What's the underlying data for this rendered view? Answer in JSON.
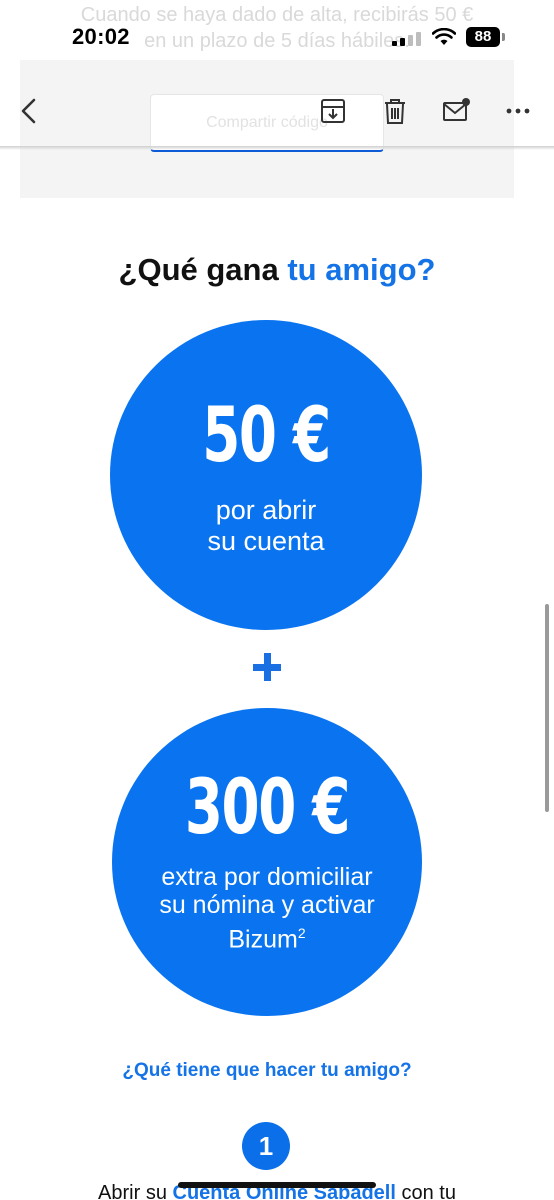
{
  "background_email": {
    "line1": "Cuando se haya dado de alta, recibirás 50 €",
    "line2": "en un plazo de 5 días hábiles.",
    "button_label": "Compartir código"
  },
  "status_bar": {
    "time": "20:02",
    "battery": "88"
  },
  "toolbar": {
    "icons": [
      "back-chevron-icon",
      "archive-icon",
      "trash-icon",
      "mark-unread-icon",
      "more-icon"
    ]
  },
  "heading": {
    "prefix": "¿Qué gana ",
    "accent": "tu amigo?"
  },
  "offer1": {
    "amount": "50 €",
    "line1": "por abrir",
    "line2": "su cuenta"
  },
  "offer2": {
    "amount": "300 €",
    "line1": "extra por domiciliar",
    "line2": "su nómina y activar",
    "line3": "Bizum",
    "superscript": "2"
  },
  "question_link": "¿Qué tiene que hacer tu amigo?",
  "step": {
    "number": "1",
    "text_prefix": "Abrir su ",
    "link": "Cuenta Online Sabadell",
    "text_suffix": " con tu"
  },
  "colors": {
    "accent": "#1473e6",
    "circle": "#0a74f0"
  }
}
